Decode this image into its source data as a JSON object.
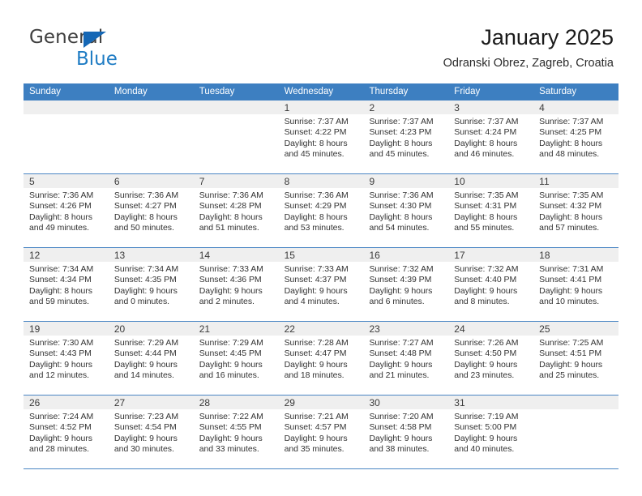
{
  "brand": {
    "name_dark": "General",
    "name_blue": "Blue",
    "triangle_color": "#1567b5",
    "blue_color": "#1f7cc4"
  },
  "header": {
    "title": "January 2025",
    "subtitle": "Odranski Obrez, Zagreb, Croatia"
  },
  "theme": {
    "header_blue": "#3d7fc1",
    "grid_line": "#4a86c4",
    "day_band": "#efefef"
  },
  "weekdays": [
    "Sunday",
    "Monday",
    "Tuesday",
    "Wednesday",
    "Thursday",
    "Friday",
    "Saturday"
  ],
  "weeks": [
    [
      {
        "day": "",
        "lines": [
          "",
          "",
          "",
          ""
        ]
      },
      {
        "day": "",
        "lines": [
          "",
          "",
          "",
          ""
        ]
      },
      {
        "day": "",
        "lines": [
          "",
          "",
          "",
          ""
        ]
      },
      {
        "day": "1",
        "lines": [
          "Sunrise: 7:37 AM",
          "Sunset: 4:22 PM",
          "Daylight: 8 hours",
          "and 45 minutes."
        ]
      },
      {
        "day": "2",
        "lines": [
          "Sunrise: 7:37 AM",
          "Sunset: 4:23 PM",
          "Daylight: 8 hours",
          "and 45 minutes."
        ]
      },
      {
        "day": "3",
        "lines": [
          "Sunrise: 7:37 AM",
          "Sunset: 4:24 PM",
          "Daylight: 8 hours",
          "and 46 minutes."
        ]
      },
      {
        "day": "4",
        "lines": [
          "Sunrise: 7:37 AM",
          "Sunset: 4:25 PM",
          "Daylight: 8 hours",
          "and 48 minutes."
        ]
      }
    ],
    [
      {
        "day": "5",
        "lines": [
          "Sunrise: 7:36 AM",
          "Sunset: 4:26 PM",
          "Daylight: 8 hours",
          "and 49 minutes."
        ]
      },
      {
        "day": "6",
        "lines": [
          "Sunrise: 7:36 AM",
          "Sunset: 4:27 PM",
          "Daylight: 8 hours",
          "and 50 minutes."
        ]
      },
      {
        "day": "7",
        "lines": [
          "Sunrise: 7:36 AM",
          "Sunset: 4:28 PM",
          "Daylight: 8 hours",
          "and 51 minutes."
        ]
      },
      {
        "day": "8",
        "lines": [
          "Sunrise: 7:36 AM",
          "Sunset: 4:29 PM",
          "Daylight: 8 hours",
          "and 53 minutes."
        ]
      },
      {
        "day": "9",
        "lines": [
          "Sunrise: 7:36 AM",
          "Sunset: 4:30 PM",
          "Daylight: 8 hours",
          "and 54 minutes."
        ]
      },
      {
        "day": "10",
        "lines": [
          "Sunrise: 7:35 AM",
          "Sunset: 4:31 PM",
          "Daylight: 8 hours",
          "and 55 minutes."
        ]
      },
      {
        "day": "11",
        "lines": [
          "Sunrise: 7:35 AM",
          "Sunset: 4:32 PM",
          "Daylight: 8 hours",
          "and 57 minutes."
        ]
      }
    ],
    [
      {
        "day": "12",
        "lines": [
          "Sunrise: 7:34 AM",
          "Sunset: 4:34 PM",
          "Daylight: 8 hours",
          "and 59 minutes."
        ]
      },
      {
        "day": "13",
        "lines": [
          "Sunrise: 7:34 AM",
          "Sunset: 4:35 PM",
          "Daylight: 9 hours",
          "and 0 minutes."
        ]
      },
      {
        "day": "14",
        "lines": [
          "Sunrise: 7:33 AM",
          "Sunset: 4:36 PM",
          "Daylight: 9 hours",
          "and 2 minutes."
        ]
      },
      {
        "day": "15",
        "lines": [
          "Sunrise: 7:33 AM",
          "Sunset: 4:37 PM",
          "Daylight: 9 hours",
          "and 4 minutes."
        ]
      },
      {
        "day": "16",
        "lines": [
          "Sunrise: 7:32 AM",
          "Sunset: 4:39 PM",
          "Daylight: 9 hours",
          "and 6 minutes."
        ]
      },
      {
        "day": "17",
        "lines": [
          "Sunrise: 7:32 AM",
          "Sunset: 4:40 PM",
          "Daylight: 9 hours",
          "and 8 minutes."
        ]
      },
      {
        "day": "18",
        "lines": [
          "Sunrise: 7:31 AM",
          "Sunset: 4:41 PM",
          "Daylight: 9 hours",
          "and 10 minutes."
        ]
      }
    ],
    [
      {
        "day": "19",
        "lines": [
          "Sunrise: 7:30 AM",
          "Sunset: 4:43 PM",
          "Daylight: 9 hours",
          "and 12 minutes."
        ]
      },
      {
        "day": "20",
        "lines": [
          "Sunrise: 7:29 AM",
          "Sunset: 4:44 PM",
          "Daylight: 9 hours",
          "and 14 minutes."
        ]
      },
      {
        "day": "21",
        "lines": [
          "Sunrise: 7:29 AM",
          "Sunset: 4:45 PM",
          "Daylight: 9 hours",
          "and 16 minutes."
        ]
      },
      {
        "day": "22",
        "lines": [
          "Sunrise: 7:28 AM",
          "Sunset: 4:47 PM",
          "Daylight: 9 hours",
          "and 18 minutes."
        ]
      },
      {
        "day": "23",
        "lines": [
          "Sunrise: 7:27 AM",
          "Sunset: 4:48 PM",
          "Daylight: 9 hours",
          "and 21 minutes."
        ]
      },
      {
        "day": "24",
        "lines": [
          "Sunrise: 7:26 AM",
          "Sunset: 4:50 PM",
          "Daylight: 9 hours",
          "and 23 minutes."
        ]
      },
      {
        "day": "25",
        "lines": [
          "Sunrise: 7:25 AM",
          "Sunset: 4:51 PM",
          "Daylight: 9 hours",
          "and 25 minutes."
        ]
      }
    ],
    [
      {
        "day": "26",
        "lines": [
          "Sunrise: 7:24 AM",
          "Sunset: 4:52 PM",
          "Daylight: 9 hours",
          "and 28 minutes."
        ]
      },
      {
        "day": "27",
        "lines": [
          "Sunrise: 7:23 AM",
          "Sunset: 4:54 PM",
          "Daylight: 9 hours",
          "and 30 minutes."
        ]
      },
      {
        "day": "28",
        "lines": [
          "Sunrise: 7:22 AM",
          "Sunset: 4:55 PM",
          "Daylight: 9 hours",
          "and 33 minutes."
        ]
      },
      {
        "day": "29",
        "lines": [
          "Sunrise: 7:21 AM",
          "Sunset: 4:57 PM",
          "Daylight: 9 hours",
          "and 35 minutes."
        ]
      },
      {
        "day": "30",
        "lines": [
          "Sunrise: 7:20 AM",
          "Sunset: 4:58 PM",
          "Daylight: 9 hours",
          "and 38 minutes."
        ]
      },
      {
        "day": "31",
        "lines": [
          "Sunrise: 7:19 AM",
          "Sunset: 5:00 PM",
          "Daylight: 9 hours",
          "and 40 minutes."
        ]
      },
      {
        "day": "",
        "lines": [
          "",
          "",
          "",
          ""
        ]
      }
    ]
  ]
}
